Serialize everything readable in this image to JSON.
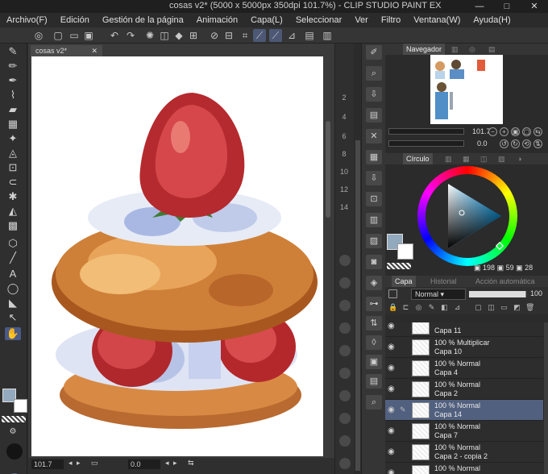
{
  "window": {
    "title": "cosas v2* (5000 x 5000px 350dpi 101.7%) - CLIP STUDIO PAINT EX",
    "minimize": "—",
    "maximize": "□",
    "close": "✕"
  },
  "menu": [
    "Archivo(F)",
    "Edición",
    "Gestión de la página",
    "Animación",
    "Capa(L)",
    "Seleccionar",
    "Ver",
    "Filtro",
    "Ventana(W)",
    "Ayuda(H)"
  ],
  "document": {
    "tab_label": "cosas v2*",
    "tab_close": "✕"
  },
  "status": {
    "zoom": "101.7",
    "position": "0.0"
  },
  "ruler_ticks": [
    "2",
    "4",
    "6",
    "8",
    "10",
    "12",
    "14"
  ],
  "navigator": {
    "tab": "Navegador",
    "zoom": "101.7",
    "angle": "0.0"
  },
  "color_panel": {
    "tab": "Círculo",
    "h": "198",
    "s": "59",
    "v": "28",
    "main_color": "#93a9bd",
    "sub_color": "#ffffff"
  },
  "layer_panel": {
    "tabs": [
      "Capa",
      "Historial",
      "Acción automática"
    ],
    "blend_mode": "Normal",
    "opacity": "100",
    "layers": [
      {
        "mode": "",
        "name": "Capa 11",
        "selected": false
      },
      {
        "mode": "100 % Multiplicar",
        "name": "Capa 10",
        "selected": false
      },
      {
        "mode": "100 % Normal",
        "name": "Capa 4",
        "selected": false
      },
      {
        "mode": "100 % Normal",
        "name": "Capa 2",
        "selected": false
      },
      {
        "mode": "100 % Normal",
        "name": "Capa 14",
        "selected": true
      },
      {
        "mode": "100 % Normal",
        "name": "Capa 7",
        "selected": false
      },
      {
        "mode": "100 % Normal",
        "name": "Capa 2 - copia 2",
        "selected": false
      },
      {
        "mode": "100 % Normal",
        "name": "",
        "selected": false
      }
    ]
  }
}
